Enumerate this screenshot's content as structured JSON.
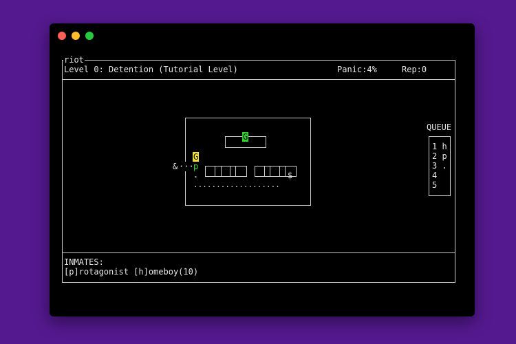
{
  "window": {
    "title": "riot",
    "traffic_lights": {
      "close": "#fe5f57",
      "minimize": "#febc2e",
      "zoom": "#28c840"
    }
  },
  "status": {
    "level": "Level 0: Detention (Tutorial Level)",
    "panic": "Panic:4%",
    "rep": "Rep:0"
  },
  "map": {
    "guard_top": "G",
    "guard_left": "G",
    "player": "p",
    "ampersand": "&",
    "trail": "···",
    "dot_below_player": ".",
    "dollar": "$",
    "dotted_row": "...................",
    "colors": {
      "guard_active": "#2fd12f",
      "guard_alert": "#f3e23a",
      "player": "#46e046"
    }
  },
  "queue": {
    "label": "QUEUE",
    "slots": [
      {
        "num": "1",
        "val": "h"
      },
      {
        "num": "2",
        "val": "p"
      },
      {
        "num": "3",
        "val": "."
      },
      {
        "num": "4",
        "val": ""
      },
      {
        "num": "5",
        "val": ""
      }
    ]
  },
  "inmates": {
    "label": "INMATES:",
    "list": "[p]rotagonist [h]omeboy(10)"
  }
}
